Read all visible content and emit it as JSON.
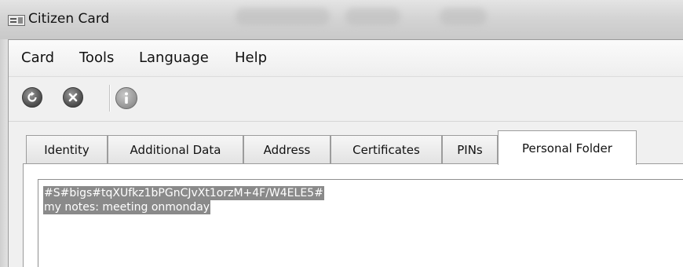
{
  "window": {
    "title": "Citizen Card"
  },
  "menu": {
    "items": [
      "Card",
      "Tools",
      "Language",
      "Help"
    ]
  },
  "toolbar": {
    "icons": [
      "refresh-icon",
      "close-icon",
      "info-icon"
    ]
  },
  "tabs": {
    "items": [
      "Identity",
      "Additional Data",
      "Address",
      "Certificates",
      "PINs",
      "Personal Folder"
    ],
    "active": "Personal Folder"
  },
  "notes": {
    "lines": [
      "#S#bigs#tqXUfkz1bPGnCJvXt1orzM+4F/W4ELE5#",
      "my notes: meeting onmonday"
    ]
  }
}
